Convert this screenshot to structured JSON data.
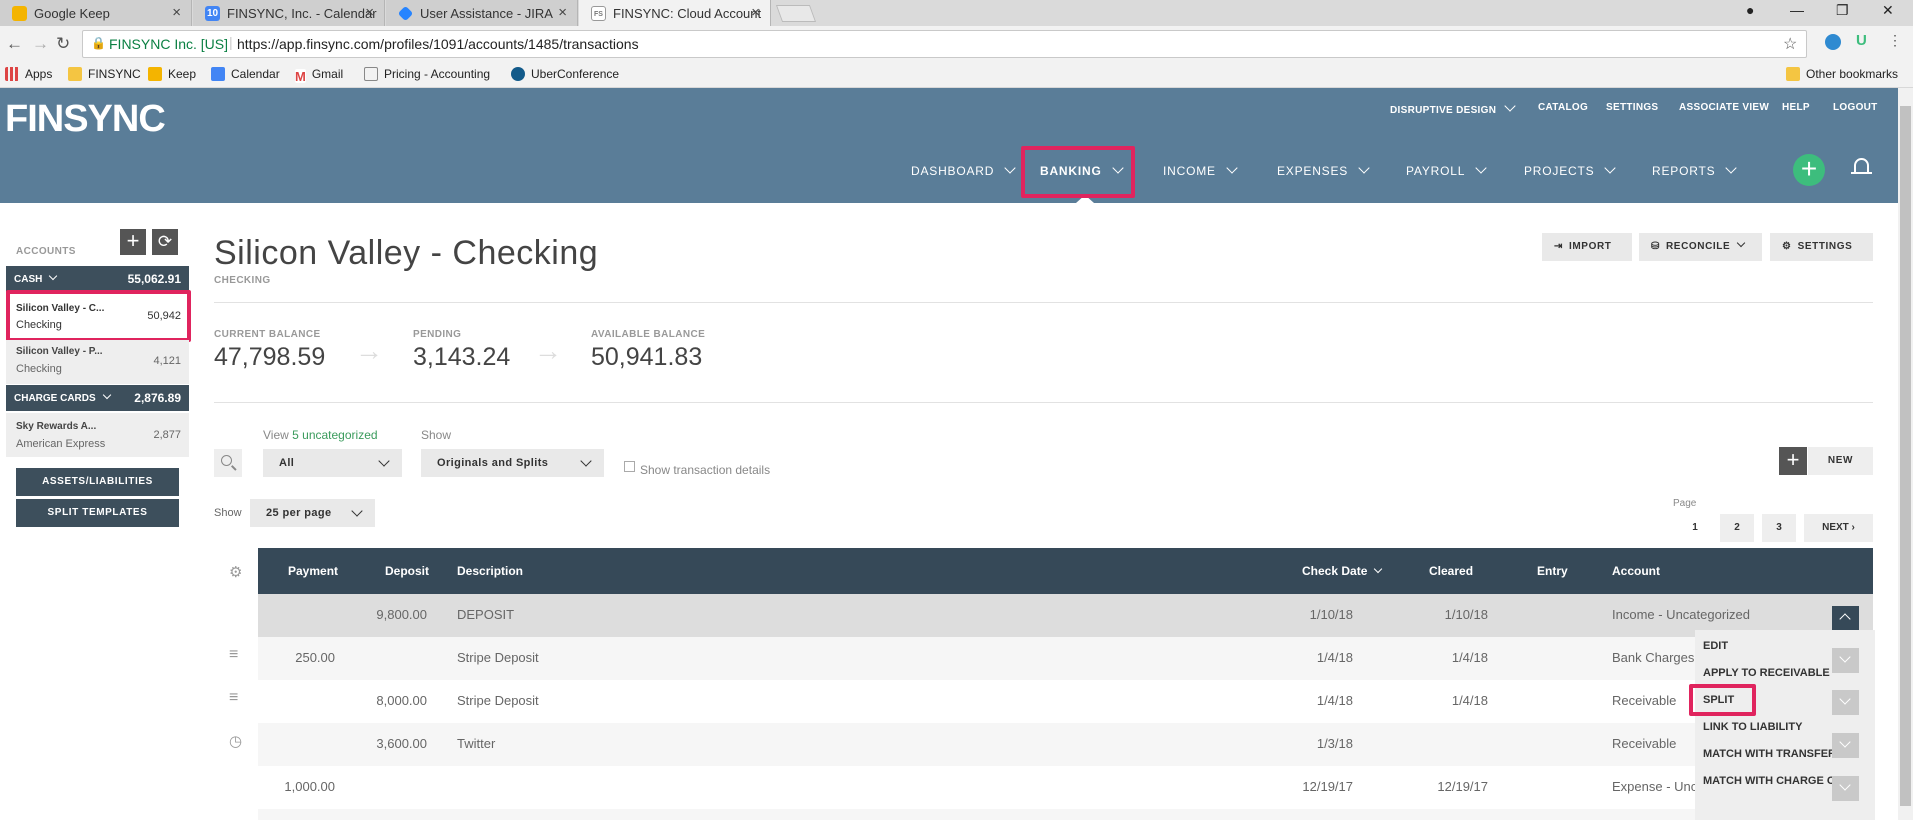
{
  "browser": {
    "tabs": [
      {
        "title": "Google Keep",
        "icon_color": "#f4b400",
        "icon": "keep-icon"
      },
      {
        "title": "FINSYNC, Inc. - Calendar",
        "icon_color": "#4285f4",
        "icon": "calendar-icon"
      },
      {
        "title": "User Assistance - JIRA",
        "icon_color": "#2684ff",
        "icon": "jira-icon"
      },
      {
        "title": "FINSYNC: Cloud Account",
        "icon_color": "#888888",
        "icon": "finsync-icon"
      }
    ],
    "secure_label": "FINSYNC Inc. [US]",
    "url": "https://app.finsync.com/profiles/1091/accounts/1485/transactions",
    "bookmarks": [
      "Apps",
      "FINSYNC",
      "Keep",
      "Calendar",
      "Gmail",
      "Pricing - Accounting",
      "UberConference"
    ],
    "other_bookmarks": "Other bookmarks"
  },
  "header": {
    "logo": "FINSYNC",
    "top_links": [
      "DISRUPTIVE DESIGN",
      "CATALOG",
      "SETTINGS",
      "ASSOCIATE VIEW",
      "HELP",
      "LOGOUT"
    ],
    "nav": [
      "DASHBOARD",
      "BANKING",
      "INCOME",
      "EXPENSES",
      "PAYROLL",
      "PROJECTS",
      "REPORTS"
    ],
    "add_symbol": "+",
    "bell_icon": "bell-icon",
    "highlight_color": "#e0245e",
    "brand_color": "#5a7d98",
    "add_color": "#3dbd7d"
  },
  "sidebar": {
    "title": "ACCOUNTS",
    "add_symbol": "+",
    "refresh_symbol": "⟳",
    "cash": {
      "label": "CASH",
      "total": "55,062.91"
    },
    "cash_accounts": [
      {
        "name": "Silicon Valley - C...",
        "type": "Checking",
        "balance": "50,942"
      },
      {
        "name": "Silicon Valley - P...",
        "type": "Checking",
        "balance": "4,121"
      }
    ],
    "charge": {
      "label": "CHARGE CARDS",
      "total": "2,876.89"
    },
    "charge_accounts": [
      {
        "name": "Sky Rewards A...",
        "type": "American Express",
        "balance": "2,877"
      }
    ],
    "buttons": [
      "ASSETS/LIABILITIES",
      "SPLIT TEMPLATES"
    ]
  },
  "account": {
    "title": "Silicon Valley - Checking",
    "subtitle": "CHECKING",
    "actions": [
      "IMPORT",
      "RECONCILE",
      "SETTINGS"
    ],
    "current_balance_label": "CURRENT BALANCE",
    "current_balance": "47,798.59",
    "pending_label": "PENDING",
    "pending": "3,143.24",
    "available_label": "AVAILABLE BALANCE",
    "available": "50,941.83"
  },
  "filters": {
    "view_label": "View",
    "uncategorized": "5 uncategorized",
    "view_value": "All",
    "show_label": "Show",
    "show_value": "Originals and Splits",
    "details_label": "Show transaction details",
    "per_page_label": "Show",
    "per_page": "25 per page",
    "new_label": "NEW",
    "new_symbol": "+",
    "page_label": "Page",
    "pages": [
      "1",
      "2",
      "3"
    ],
    "next": "NEXT ›"
  },
  "table": {
    "columns": [
      "Payment",
      "Deposit",
      "Description",
      "Check Date",
      "Cleared",
      "Entry",
      "Account"
    ],
    "rows": [
      {
        "payment": "",
        "deposit": "9,800.00",
        "description": "DEPOSIT",
        "check_date": "1/10/18",
        "cleared": "1/10/18",
        "entry": "",
        "account": "Income - Uncategorized",
        "icon": ""
      },
      {
        "payment": "250.00",
        "deposit": "",
        "description": "Stripe Deposit",
        "check_date": "1/4/18",
        "cleared": "1/4/18",
        "entry": "",
        "account": "Bank Charges",
        "icon": "≡"
      },
      {
        "payment": "",
        "deposit": "8,000.00",
        "description": "Stripe Deposit",
        "check_date": "1/4/18",
        "cleared": "1/4/18",
        "entry": "",
        "account": "Receivable",
        "icon": "≡"
      },
      {
        "payment": "",
        "deposit": "3,600.00",
        "description": "Twitter",
        "check_date": "1/3/18",
        "cleared": "",
        "entry": "",
        "account": "Receivable",
        "icon": "◷"
      },
      {
        "payment": "1,000.00",
        "deposit": "",
        "description": "",
        "check_date": "12/19/17",
        "cleared": "12/19/17",
        "entry": "",
        "account": "Expense - Unc",
        "icon": ""
      }
    ],
    "menu": [
      "EDIT",
      "APPLY TO RECEIVABLE",
      "SPLIT",
      "LINK TO LIABILITY",
      "MATCH WITH TRANSFER",
      "MATCH WITH CHARGE C"
    ]
  }
}
